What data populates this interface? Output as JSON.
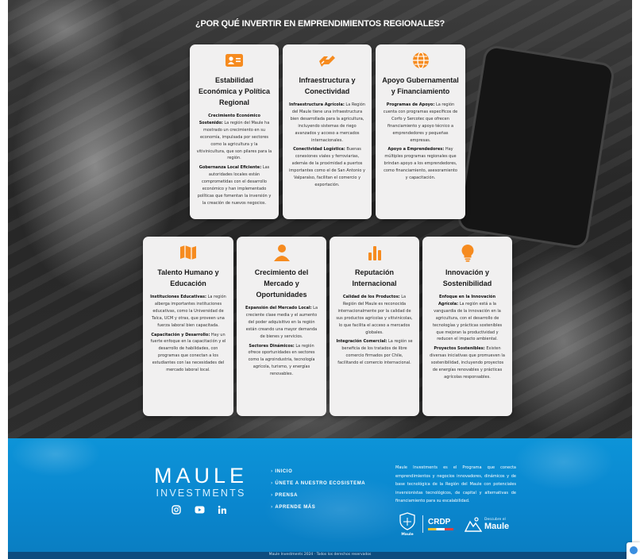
{
  "hero": {
    "title": "¿POR QUÉ INVERTIR EN EMPRENDIMIENTOS REGIONALES?",
    "cards": [
      {
        "icon": "id-card-icon",
        "title": "Estabilidad Económica y Política Regional",
        "paragraphs": [
          {
            "lead": "Crecimiento Económico Sostenido:",
            "text": "La región del Maule ha mostrado un crecimiento en su economía, impulsada por sectores como la agricultura y la vitivinicultura, que son pilares para la región."
          },
          {
            "lead": "Gobernanza Local Eficiente:",
            "text": "Las autoridades locales están comprometidas con el desarrollo económico y han implementado políticas que fomentan la inversión y la creación de nuevos negocios."
          }
        ]
      },
      {
        "icon": "handshake-icon",
        "title": "Infraestructura y Conectividad",
        "paragraphs": [
          {
            "lead": "Infraestructura Agrícola:",
            "text": "La Región del Maule tiene una infraestructura bien desarrollada para la agricultura, incluyendo sistemas de riego avanzados y acceso a mercados internacionales."
          },
          {
            "lead": "Conectividad Logística:",
            "text": "Buenas conexiones viales y ferroviarias, además de la proximidad a puertos importantes como el de San Antonio y Valparaíso, facilitan el comercio y exportación."
          }
        ]
      },
      {
        "icon": "globe-icon",
        "title": "Apoyo Gubernamental y Financiamiento",
        "paragraphs": [
          {
            "lead": "Programas de Apoyo:",
            "text": "La región cuenta con programas específicos de Corfo y Sercotec que ofrecen financiamiento y apoyo técnico a emprendedores y pequeñas empresas."
          },
          {
            "lead": "Apoyo a Emprendedores:",
            "text": "Hay múltiples programas regionales que brindan apoyo a los emprendedores, como financiamiento, asesoramiento y capacitación."
          }
        ]
      },
      {
        "icon": "map-icon",
        "title": "Talento Humano y Educación",
        "paragraphs": [
          {
            "lead": "Instituciones Educativas:",
            "text": "La región alberga importantes instituciones educativas, como la Universidad de Talca, UCM y otras, que proveen una fuerza laboral bien capacitada."
          },
          {
            "lead": "Capacitación y Desarrollo:",
            "text": "Hay un fuerte enfoque en la capacitación y el desarrollo de habilidades, con programas que conectan a los estudiantes con las necesidades del mercado laboral local."
          }
        ]
      },
      {
        "icon": "person-icon",
        "title": "Crecimiento del Mercado y Oportunidades",
        "paragraphs": [
          {
            "lead": "Expansión del Mercado Local:",
            "text": "La creciente clase media y el aumento del poder adquisitivo en la región están creando una mayor demanda de bienes y servicios."
          },
          {
            "lead": "Sectores Dinámicos:",
            "text": "La región ofrece oportunidades en sectores como la agroindustria, tecnología agrícola, turismo, y energías renovables."
          }
        ]
      },
      {
        "icon": "bar-chart-icon",
        "title": "Reputación Internacional",
        "paragraphs": [
          {
            "lead": "Calidad de los Productos:",
            "text": "La Región del Maule es reconocida internacionalmente por la calidad de sus productos agrícolas y vitivinícolas, lo que facilita el acceso a mercados globales."
          },
          {
            "lead": "Integración Comercial:",
            "text": "La región se beneficia de los tratados de libre comercio firmados por Chile, facilitando el comercio internacional."
          }
        ]
      },
      {
        "icon": "lightbulb-icon",
        "title": "Innovación y Sostenibilidad",
        "paragraphs": [
          {
            "lead": "Enfoque en la Innovación Agrícola:",
            "text": "La región está a la vanguardia de la innovación en la agricultura, con el desarrollo de tecnologías y prácticas sostenibles que mejoran la productividad y reducen el impacto ambiental."
          },
          {
            "lead": "Proyectos Sostenibles:",
            "text": "Existen diversas iniciativas que promueven la sostenibilidad, incluyendo proyectos de energías renovables y prácticas agrícolas responsables."
          }
        ]
      }
    ]
  },
  "footer": {
    "brand_name": "MAULE",
    "brand_sub": "INVESTMENTS",
    "social": [
      "instagram-icon",
      "youtube-icon",
      "linkedin-icon"
    ],
    "menu": [
      "INICIO",
      "ÚNETE A NUESTRO ECOSISTEMA",
      "PRENSA",
      "APRENDE MÁS"
    ],
    "about": "Maule Investments es el Programa que conecta emprendimientos y negocios innovadores, dinámicos y de base tecnológica de la Región del Maule con potenciales inversionistas tecnológicos, de capital y alternativas de financiamiento para su escalabilidad.",
    "logos": {
      "maule_label": "Maule",
      "crdp_label": "CRDP",
      "dm_small": "Descubre el",
      "dm_big": "Maule"
    },
    "bottom_text": "Maule Investments 2024 · Todos los derechos reservados",
    "colors": {
      "accent": "#f68b1f",
      "footer_blue": "#0a87cf",
      "card_bg": "#f1f0f0"
    }
  }
}
